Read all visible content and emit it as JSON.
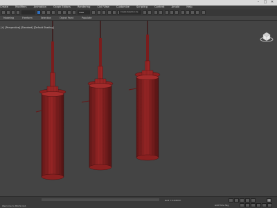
{
  "menubar": {
    "items": [
      "Create",
      "Modifiers",
      "Animation",
      "Graph Editors",
      "Rendering",
      "Civil View",
      "Customize",
      "Scripting",
      "Content",
      "Arnold",
      "Help"
    ]
  },
  "toolbar": {
    "view_dropdown": "View",
    "selection_set_placeholder": "Create Selection Se"
  },
  "ribbon": {
    "tabs": [
      "Modeling",
      "Freeform",
      "Selection",
      "Object Paint",
      "Populate"
    ]
  },
  "viewport": {
    "label": "[+] [Perspective] [Standard] [Default Shading]",
    "object_color": "#9a2626",
    "wire_color": "#4a0d0d"
  },
  "status": {
    "left_text": "Welcome to MAXScript.",
    "coords_text": "Grid = 10,0mm",
    "tag_text": "Add Time Tag"
  }
}
